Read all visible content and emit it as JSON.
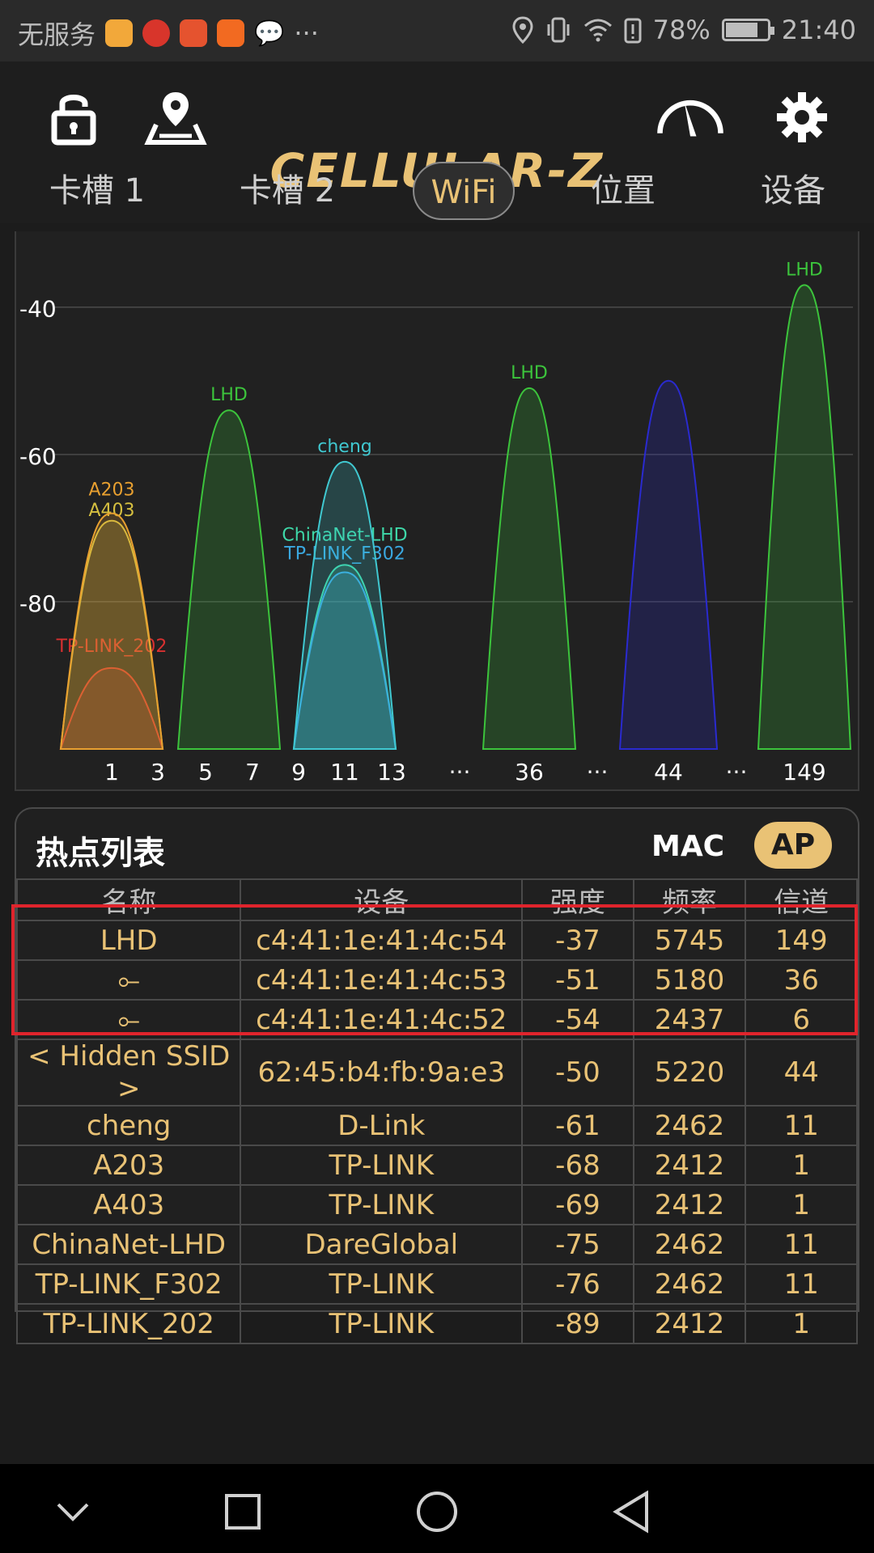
{
  "status": {
    "carrier": "无服务",
    "more": "···",
    "battery": "78%",
    "battery_level": 0.78,
    "time": "21:40",
    "app_icons": [
      "weibo-icon",
      "app-red-icon",
      "app-orange-icon",
      "taobao-icon",
      "wechat-icon"
    ]
  },
  "toolbar": {
    "logo": "CELLULAR-Z"
  },
  "tabs": [
    {
      "label": "卡槽 1",
      "active": false
    },
    {
      "label": "卡槽 2",
      "active": false
    },
    {
      "label": "WiFi",
      "active": true
    },
    {
      "label": "位置",
      "active": false
    },
    {
      "label": "设备",
      "active": false
    }
  ],
  "chart_data": {
    "type": "area",
    "ylim": [
      -100,
      -33
    ],
    "yticks": [
      "-40",
      "-60",
      "-80"
    ],
    "ytick_values": [
      -40,
      -60,
      -80
    ],
    "xtick_labels": [
      "1",
      "3",
      "5",
      "7",
      "9",
      "11",
      "13",
      "···",
      "36",
      "···",
      "44",
      "···",
      "149"
    ],
    "series": [
      {
        "name": "TP-LINK_202",
        "channel": 1,
        "rssi": -89,
        "color": "#d93030"
      },
      {
        "name": "A403",
        "channel": 1,
        "rssi": -69,
        "color": "#d6c040"
      },
      {
        "name": "A203",
        "channel": 1,
        "rssi": -68,
        "color": "#e8a030"
      },
      {
        "name": "LHD",
        "channel": 6,
        "rssi": -54,
        "color": "#3cc43c"
      },
      {
        "name": "ChinaNet-LHD",
        "channel": 11,
        "rssi": -75,
        "color": "#3ed8a8"
      },
      {
        "name": "TP-LINK_F302",
        "channel": 11,
        "rssi": -76,
        "color": "#3aa8e0"
      },
      {
        "name": "cheng",
        "channel": 11,
        "rssi": -61,
        "color": "#40c8d0"
      },
      {
        "name": "LHD",
        "channel": 36,
        "rssi": -51,
        "color": "#3cc43c"
      },
      {
        "name": "",
        "channel": 44,
        "rssi": -50,
        "color": "#2a2ad0"
      },
      {
        "name": "LHD",
        "channel": 149,
        "rssi": -37,
        "color": "#3cc43c"
      }
    ]
  },
  "list": {
    "title": "热点列表",
    "mac_label": "MAC",
    "ap_label": "AP",
    "headers": {
      "name": "名称",
      "device": "设备",
      "strength": "强度",
      "freq": "频率",
      "channel": "信道"
    },
    "rows": [
      {
        "name": "LHD",
        "device": "c4:41:1e:41:4c:54",
        "strength": "-37",
        "freq": "5745",
        "channel": "149"
      },
      {
        "name": "⟜",
        "device": "c4:41:1e:41:4c:53",
        "strength": "-51",
        "freq": "5180",
        "channel": "36"
      },
      {
        "name": "⟜",
        "device": "c4:41:1e:41:4c:52",
        "strength": "-54",
        "freq": "2437",
        "channel": "6"
      },
      {
        "name": "< Hidden SSID >",
        "device": "62:45:b4:fb:9a:e3",
        "strength": "-50",
        "freq": "5220",
        "channel": "44"
      },
      {
        "name": "cheng",
        "device": "D-Link",
        "strength": "-61",
        "freq": "2462",
        "channel": "11"
      },
      {
        "name": "A203",
        "device": "TP-LINK",
        "strength": "-68",
        "freq": "2412",
        "channel": "1"
      },
      {
        "name": "A403",
        "device": "TP-LINK",
        "strength": "-69",
        "freq": "2412",
        "channel": "1"
      },
      {
        "name": "ChinaNet-LHD",
        "device": "DareGlobal",
        "strength": "-75",
        "freq": "2462",
        "channel": "11"
      },
      {
        "name": "TP-LINK_F302",
        "device": "TP-LINK",
        "strength": "-76",
        "freq": "2462",
        "channel": "11"
      },
      {
        "name": "TP-LINK_202",
        "device": "TP-LINK",
        "strength": "-89",
        "freq": "2412",
        "channel": "1"
      }
    ]
  },
  "colors": {
    "accent": "#e9c275",
    "highlight": "#e0242c",
    "background": "#1c1c1c"
  }
}
